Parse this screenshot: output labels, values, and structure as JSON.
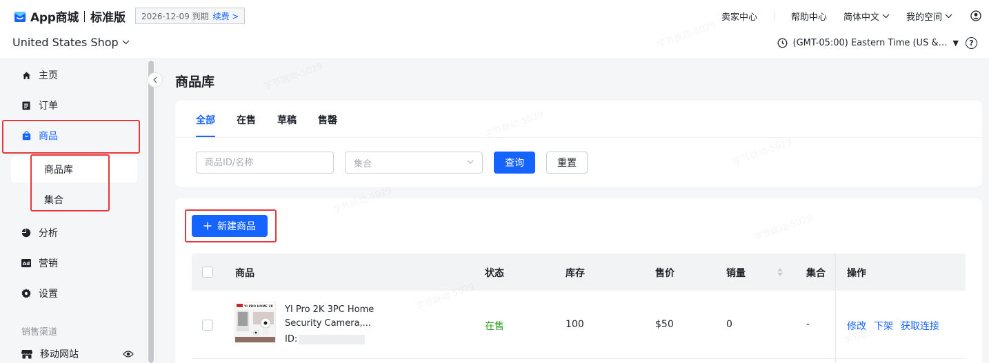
{
  "header": {
    "app_name": "App商城",
    "edition": "标准版",
    "expire_text": "2026-12-09 到期",
    "renew_label": "续费",
    "seller_center": "卖家中心",
    "help_center": "帮助中心",
    "language": "简体中文",
    "my_space": "我的空间",
    "shop_name": "United States Shop",
    "timezone": "(GMT-05:00) Eastern Time (US & Canada)",
    "icons": [
      "logo-icon",
      "chevron-down-icon",
      "user-icon",
      "clock-icon",
      "help-icon"
    ]
  },
  "sidebar": {
    "items": [
      {
        "label": "主页",
        "icon": "home-icon"
      },
      {
        "label": "订单",
        "icon": "order-icon"
      },
      {
        "label": "商品",
        "icon": "bag-icon",
        "active": true
      },
      {
        "label": "分析",
        "icon": "pie-chart-icon"
      },
      {
        "label": "营销",
        "icon": "ad-icon"
      },
      {
        "label": "设置",
        "icon": "gear-icon"
      }
    ],
    "sub_items": [
      {
        "label": "商品库",
        "active": true
      },
      {
        "label": "集合"
      }
    ],
    "section_label": "销售渠道",
    "channel": {
      "label": "移动网站",
      "icon": "store-icon",
      "action_icon": "eye-icon"
    },
    "accent_color": "#1664ff"
  },
  "main": {
    "title": "商品库",
    "tabs": [
      {
        "label": "全部",
        "active": true
      },
      {
        "label": "在售"
      },
      {
        "label": "草稿"
      },
      {
        "label": "售罄"
      }
    ],
    "filters": {
      "search_placeholder": "商品ID/名称",
      "collection_placeholder": "集合",
      "query_label": "查询",
      "reset_label": "重置"
    },
    "new_product_label": "新建商品",
    "table": {
      "columns": [
        "商品",
        "状态",
        "库存",
        "售价",
        "销量",
        "集合",
        "操作"
      ],
      "rows": [
        {
          "name": "YI Pro 2K 3PC Home Security Camera,...",
          "id_label": "ID:",
          "status": "在售",
          "stock": "100",
          "price": "$50",
          "sales": "0",
          "collection": "-",
          "actions": [
            "修改",
            "下架",
            "获取连接"
          ],
          "thumb_caption": "YI PRO HOME 2K"
        }
      ]
    },
    "status_color": "#2ea121"
  },
  "watermark": "字节跳动-5029"
}
